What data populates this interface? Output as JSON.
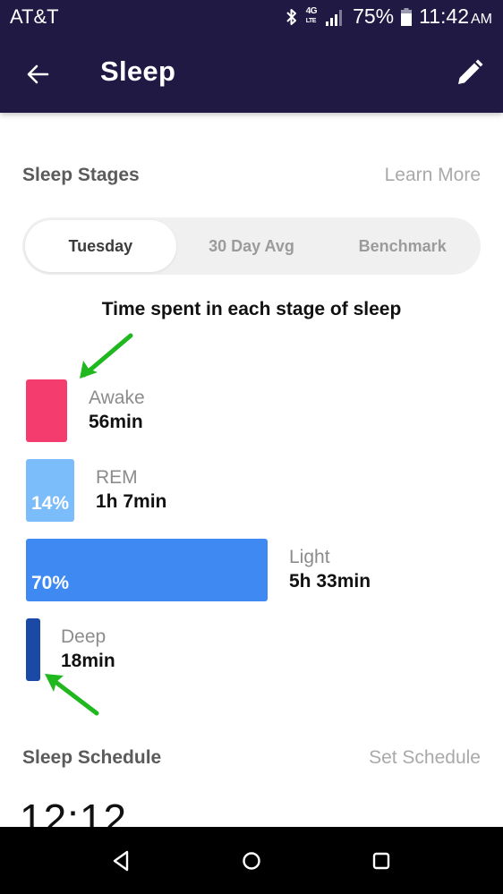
{
  "status_bar": {
    "carrier": "AT&T",
    "network": "4G",
    "network_sub": "LTE",
    "battery": "75%",
    "time": "11:42",
    "ampm": "AM"
  },
  "header": {
    "title": "Sleep",
    "back_icon": "arrow-left-icon",
    "edit_icon": "pencil-icon",
    "background_color": "#1f1944"
  },
  "sleep_stages": {
    "title": "Sleep Stages",
    "link": "Learn More",
    "tabs": [
      {
        "label": "Tuesday",
        "active": true
      },
      {
        "label": "30 Day Avg",
        "active": false
      },
      {
        "label": "Benchmark",
        "active": false
      }
    ],
    "chart_title": "Time spent in each stage of sleep",
    "stages": [
      {
        "name": "Awake",
        "duration": "56min",
        "percent": null,
        "color": "#f53c6f"
      },
      {
        "name": "REM",
        "duration": "1h 7min",
        "percent": "14%",
        "color": "#7bbcfa"
      },
      {
        "name": "Light",
        "duration": "5h 33min",
        "percent": "70%",
        "color": "#3f8af2"
      },
      {
        "name": "Deep",
        "duration": "18min",
        "percent": null,
        "color": "#1a4aa6"
      }
    ]
  },
  "annotations": {
    "arrow_color": "#1fb81f",
    "arrows": [
      "points-to-awake-bar",
      "points-to-deep-bar"
    ]
  },
  "sleep_schedule": {
    "title": "Sleep Schedule",
    "link": "Set Schedule",
    "time_partial": "12:12"
  },
  "nav_bar": {
    "back": "nav-back-icon",
    "home": "nav-home-icon",
    "recents": "nav-recents-icon"
  }
}
